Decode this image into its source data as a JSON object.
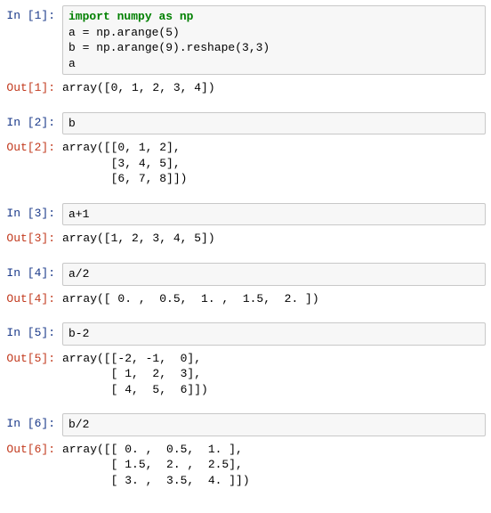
{
  "cells": [
    {
      "in_prompt": "In [1]:",
      "code_html": "<span class=\"kw\">import</span> <span class=\"kw\">numpy</span> <span class=\"kw\">as</span> <span class=\"kw\">np</span>\na = np.arange(5)\nb = np.arange(9).reshape(3,3)\na",
      "out_prompt": "Out[1]:",
      "out": "array([0, 1, 2, 3, 4])"
    },
    {
      "in_prompt": "In [2]:",
      "code_html": "b",
      "out_prompt": "Out[2]:",
      "out": "array([[0, 1, 2],\n       [3, 4, 5],\n       [6, 7, 8]])"
    },
    {
      "in_prompt": "In [3]:",
      "code_html": "a+1",
      "out_prompt": "Out[3]:",
      "out": "array([1, 2, 3, 4, 5])"
    },
    {
      "in_prompt": "In [4]:",
      "code_html": "a/2",
      "out_prompt": "Out[4]:",
      "out": "array([ 0. ,  0.5,  1. ,  1.5,  2. ])"
    },
    {
      "in_prompt": "In [5]:",
      "code_html": "b-2",
      "out_prompt": "Out[5]:",
      "out": "array([[-2, -1,  0],\n       [ 1,  2,  3],\n       [ 4,  5,  6]])"
    },
    {
      "in_prompt": "In [6]:",
      "code_html": "b/2",
      "out_prompt": "Out[6]:",
      "out": "array([[ 0. ,  0.5,  1. ],\n       [ 1.5,  2. ,  2.5],\n       [ 3. ,  3.5,  4. ]])"
    }
  ]
}
